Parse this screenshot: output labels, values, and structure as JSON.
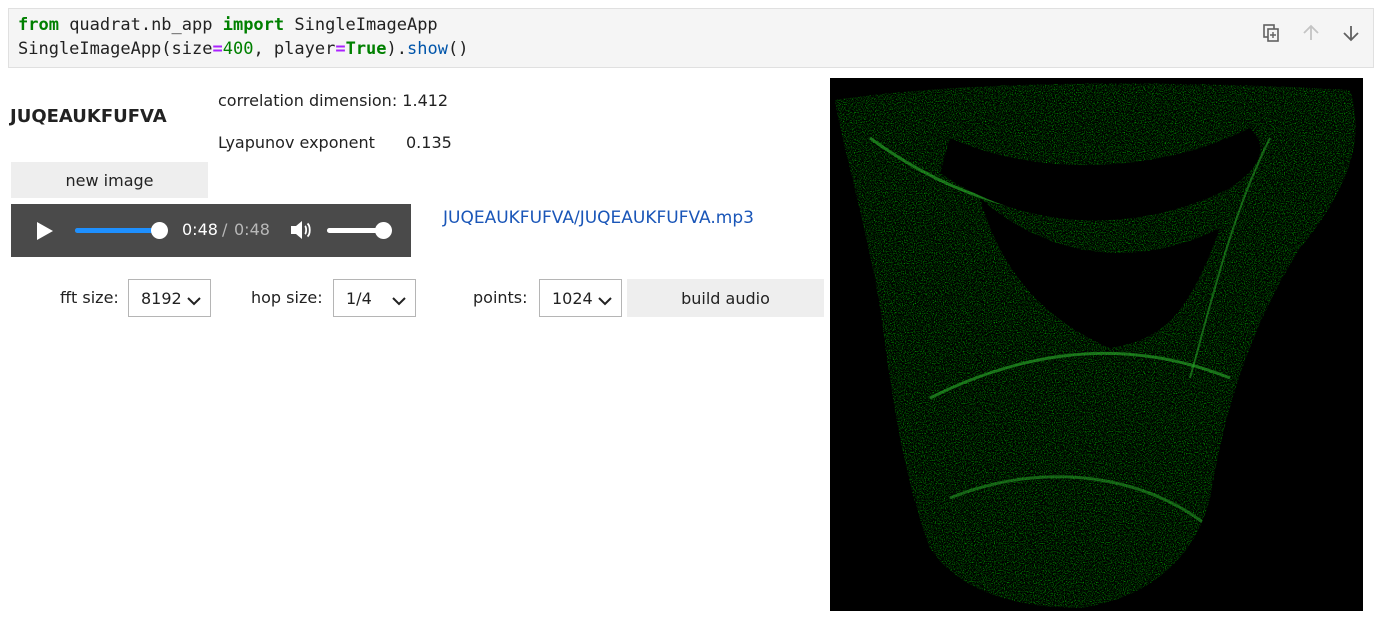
{
  "code": {
    "line1": {
      "kw_from": "from",
      "module": " quadrat.nb_app ",
      "kw_import": "import",
      "name": " SingleImageApp"
    },
    "line2": {
      "call": "SingleImageApp(size",
      "eq1": "=",
      "size": "400",
      "mid": ", player",
      "eq2": "=",
      "player": "True",
      "close": ").",
      "method": "show",
      "tail": "()"
    }
  },
  "toolbar": {
    "icons": [
      "copy-icon",
      "arrow-up-icon",
      "arrow-down-icon"
    ]
  },
  "app": {
    "image_name": "JUQEAUKFUFVA",
    "correlation": "correlation dimension: 1.412",
    "lyapunov_label": "Lyapunov exponent",
    "lyapunov_value": "0.135",
    "new_image_label": "new image",
    "audio_link": "JUQEAUKFUFVA/JUQEAUKFUFVA.mp3",
    "build_audio_label": "build audio"
  },
  "player": {
    "current_time": "0:48",
    "separator": "/",
    "total_time": "0:48",
    "progress": 1.0,
    "volume": 1.0
  },
  "controls": {
    "fft_label": "fft size:",
    "fft_value": "8192",
    "hop_label": "hop size:",
    "hop_value": "1/4",
    "points_label": "points:",
    "points_value": "1024"
  },
  "colors": {
    "attractor_green": "#1f8f1f",
    "background": "#000000",
    "progress": "#1e90ff"
  }
}
